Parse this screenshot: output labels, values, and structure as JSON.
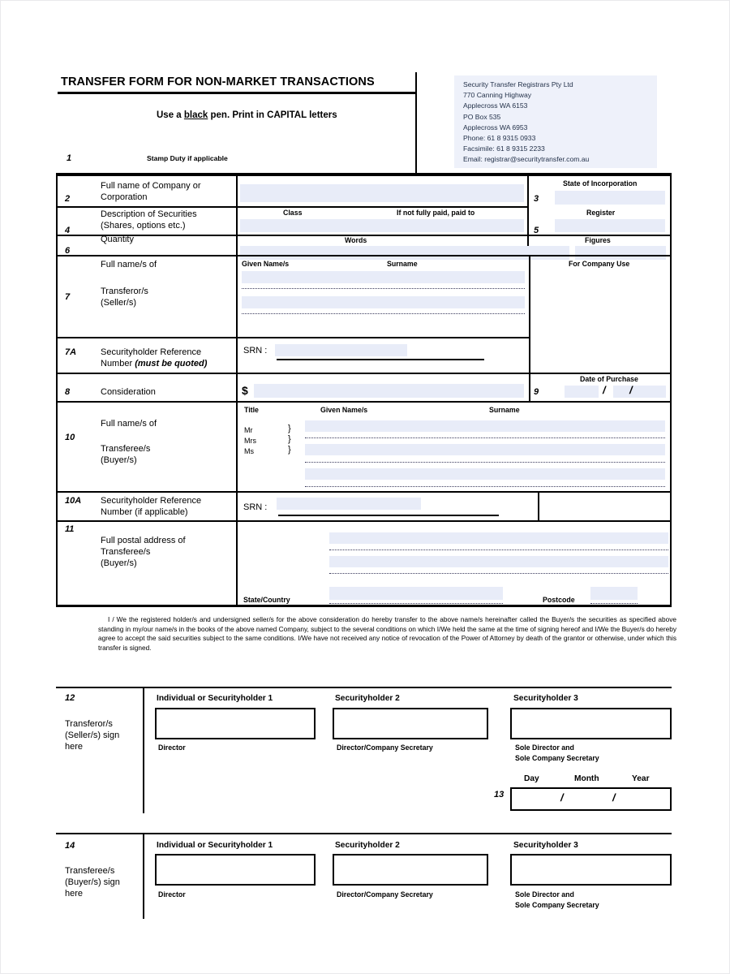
{
  "document": {
    "title": "TRANSFER FORM FOR NON-MARKET TRANSACTIONS",
    "instruction_pre": "Use a ",
    "instruction_emph": "black",
    "instruction_post": " pen. Print in CAPITAL letters"
  },
  "registrar": {
    "name": "Security Transfer Registrars Pty Ltd",
    "street": "770 Canning Highway",
    "suburb": "Applecross WA 6153",
    "po_box": "PO Box 535",
    "po_suburb": "Applecross WA 6953",
    "phone": "Phone: 61 8 9315 0933",
    "fax": "Facsimile: 61 8 9315 2233",
    "email": "Email: registrar@securitytransfer.com.au"
  },
  "sections": {
    "s1": {
      "num": "1",
      "label": "Stamp Duty  if  applicable"
    },
    "s2": {
      "num": "2",
      "label_l1": "Full name of Company or",
      "label_l2": "Corporation"
    },
    "s3": {
      "num": "3",
      "header": "State of Incorporation"
    },
    "s4": {
      "num": "4",
      "label_l1": "Description of Securities",
      "label_l2": "(Shares, options etc.)",
      "header_class": "Class",
      "header_paid": "If not fully paid,  paid to"
    },
    "s5": {
      "num": "5",
      "header": "Register"
    },
    "s6": {
      "num": "6",
      "label": "Quantity",
      "header_words": "Words",
      "header_figures": "Figures"
    },
    "s7": {
      "num": "7",
      "label_l1": "Full name/s of",
      "label_l2": "Transferor/s",
      "label_l3": "(Seller/s)",
      "header_given": "Given Name/s",
      "header_surname": "Surname",
      "header_company_use": "For Company Use"
    },
    "s7a": {
      "num": "7A",
      "label_l1": "Securityholder Reference",
      "label_l2_plain": "Number ",
      "label_l2_em": "(must be quoted)",
      "srn_label": "SRN :"
    },
    "s8": {
      "num": "8",
      "label": "Consideration",
      "currency": "$"
    },
    "s9": {
      "num": "9",
      "header": "Date of Purchase",
      "slash1": "/",
      "slash2": "/"
    },
    "s10": {
      "num": "10",
      "label_l1": "Full name/s of",
      "label_l2": "Transferee/s",
      "label_l3": "(Buyer/s)",
      "header_title": "Title",
      "header_given": "Given Name/s",
      "header_surname": "Surname",
      "titles": [
        "Mr",
        "Mrs",
        "Ms"
      ],
      "brace": "}"
    },
    "s10a": {
      "num": "10A",
      "label_l1": "Securityholder Reference",
      "label_l2": "Number (if applicable)",
      "srn_label": "SRN :"
    },
    "s11": {
      "num": "11",
      "label_l1": "Full postal address of",
      "label_l2": "Transferee/s",
      "label_l3": "(Buyer/s)",
      "state_label": "State/Country",
      "postcode_label": "Postcode"
    }
  },
  "legal": {
    "paragraph": "I / We the registered holder/s and undersigned seller/s for the above consideration do hereby transfer to the above name/s hereinafter called the Buyer/s the securities as specified above standing in my/our name/s in the books of the above named Company, subject to the several conditions on which I/We held the same at the time of signing hereof and I/We the Buyer/s do hereby agree to accept the said securities subject to the same conditions.  I/We have not received any notice of revocation of the Power of Attorney by death of the grantor or otherwise, under which this transfer is signed."
  },
  "signatures": {
    "transferor": {
      "num": "12",
      "side_l1": "Transferor/s",
      "side_l2": "(Seller/s) sign",
      "side_l3": "here",
      "boxes": [
        {
          "header": "Individual or Securityholder 1",
          "caption_l1": "Director",
          "caption_l2": ""
        },
        {
          "header": "Securityholder 2",
          "caption_l1": "Director/Company Secretary",
          "caption_l2": ""
        },
        {
          "header": "Securityholder 3",
          "caption_l1": "Sole Director and",
          "caption_l2": "Sole Company Secretary"
        }
      ]
    },
    "date": {
      "num": "13",
      "day": "Day",
      "month": "Month",
      "year": "Year",
      "slash1": "/",
      "slash2": "/"
    },
    "transferee": {
      "num": "14",
      "side_l1": "Transferee/s",
      "side_l2": "(Buyer/s) sign",
      "side_l3": "here",
      "boxes": [
        {
          "header": "Individual or Securityholder 1",
          "caption_l1": "Director",
          "caption_l2": ""
        },
        {
          "header": "Securityholder 2",
          "caption_l1": "Director/Company Secretary",
          "caption_l2": ""
        },
        {
          "header": "Securityholder 3",
          "caption_l1": "Sole Director and",
          "caption_l2": "Sole Company Secretary"
        }
      ]
    }
  },
  "colors": {
    "field_fill": "#e8ecf8",
    "rule": "#000000",
    "registrar_box": "#eef1fa"
  }
}
